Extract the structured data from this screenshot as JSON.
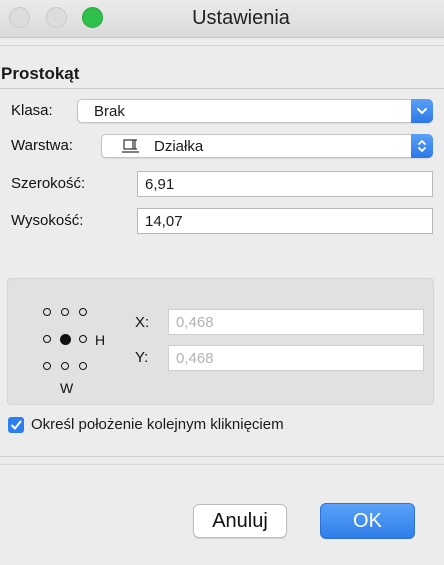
{
  "window": {
    "title": "Ustawienia"
  },
  "section": {
    "title": "Prostokąt"
  },
  "class_field": {
    "label": "Klasa:",
    "value": "Brak"
  },
  "layer_field": {
    "label": "Warstwa:",
    "value": "Działka"
  },
  "width_field": {
    "label": "Szerokość:",
    "value": "6,91"
  },
  "height_field": {
    "label": "Wysokość:",
    "value": "14,07"
  },
  "anchor": {
    "h_label": "H",
    "w_label": "W",
    "selected": "middle-center"
  },
  "coords": {
    "x_label": "X:",
    "x_value": "0,468",
    "y_label": "Y:",
    "y_value": "0,468"
  },
  "click_option": {
    "label": "Określ położenie kolejnym kliknięciem",
    "checked": true
  },
  "buttons": {
    "cancel": "Anuluj",
    "ok": "OK"
  },
  "colors": {
    "accent": "#2d7ff0",
    "zoom": "#2ec04a"
  }
}
